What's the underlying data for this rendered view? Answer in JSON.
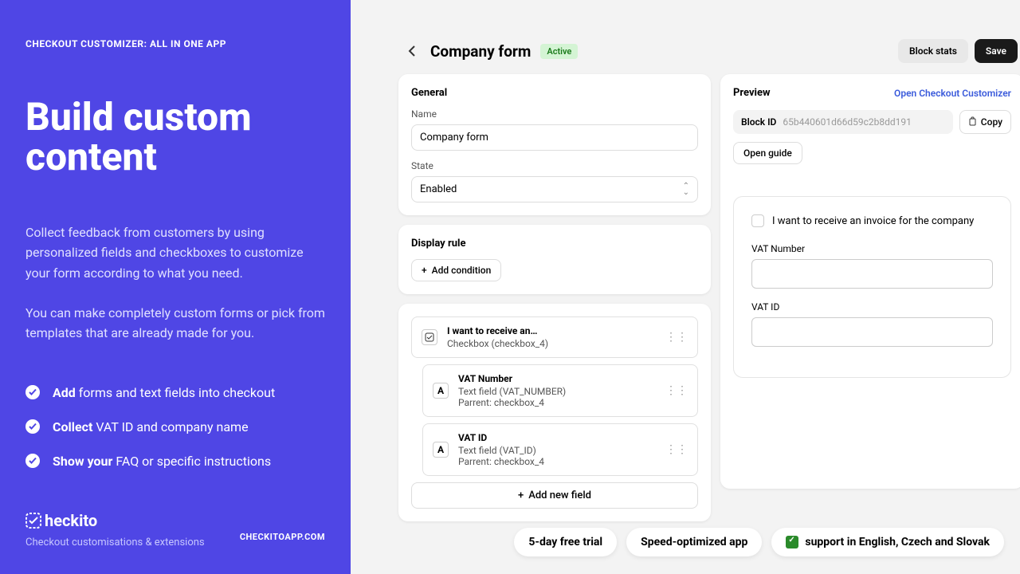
{
  "sidebar": {
    "tag": "CHECKOUT CUSTOMIZER: ALL IN ONE APP",
    "title": "Build custom content",
    "desc1": "Collect feedback from customers by using personalized fields and checkboxes to customize your form according to what you need.",
    "desc2": "You can make completely custom forms or pick from templates that are already made for you.",
    "bullets": [
      {
        "bold": "Add",
        "rest": " forms and text fields into checkout"
      },
      {
        "bold": "Collect",
        "rest": " VAT ID and company name"
      },
      {
        "bold": "Show your",
        "rest": " FAQ or specific instructions"
      }
    ],
    "logo": "heckito",
    "tagline": "Checkout customisations & extensions",
    "domain": "CHECKITOAPP.COM"
  },
  "header": {
    "title": "Company form",
    "badge": "Active",
    "blockStats": "Block stats",
    "save": "Save"
  },
  "general": {
    "title": "General",
    "nameLabel": "Name",
    "nameValue": "Company form",
    "stateLabel": "State",
    "stateValue": "Enabled"
  },
  "displayRule": {
    "title": "Display rule",
    "addCondition": "Add condition"
  },
  "fields": {
    "items": [
      {
        "title": "I want to receive an…",
        "sub": "Checkbox (checkbox_4)",
        "icon": "check"
      },
      {
        "title": "VAT Number",
        "sub": "Text field (VAT_NUMBER)",
        "parent": "Parrent: checkbox_4",
        "icon": "A"
      },
      {
        "title": "VAT ID",
        "sub": "Text field (VAT_ID)",
        "parent": "Parrent: checkbox_4",
        "icon": "A"
      }
    ],
    "addNew": "Add new field"
  },
  "preview": {
    "title": "Preview",
    "link": "Open Checkout Customizer",
    "blockIdLabel": "Block ID",
    "blockId": "65b440601d66d59c2b8dd191",
    "copy": "Copy",
    "openGuide": "Open guide",
    "checkboxLabel": "I want to receive an invoice for the company",
    "vatNumber": "VAT Number",
    "vatId": "VAT ID"
  },
  "pills": {
    "trial": "5-day free trial",
    "speed": "Speed-optimized app",
    "langs": "support in English, Czech and Slovak"
  }
}
